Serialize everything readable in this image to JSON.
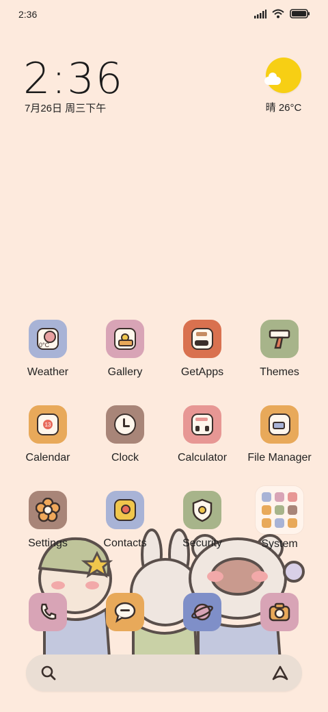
{
  "status_bar": {
    "time": "2:36"
  },
  "clock_widget": {
    "time": "2:36",
    "date": "7月26日 周三下午"
  },
  "weather_widget": {
    "text": "晴 26°C"
  },
  "apps": [
    {
      "id": "weather",
      "label": "Weather",
      "color": "#a8b3d6",
      "icon": "weather-icon"
    },
    {
      "id": "gallery",
      "label": "Gallery",
      "color": "#d8a4b6",
      "icon": "gallery-icon"
    },
    {
      "id": "getapps",
      "label": "GetApps",
      "color": "#d9714f",
      "icon": "getapps-icon"
    },
    {
      "id": "themes",
      "label": "Themes",
      "color": "#a7b48a",
      "icon": "themes-icon"
    },
    {
      "id": "calendar",
      "label": "Calendar",
      "color": "#e8a95a",
      "icon": "calendar-icon"
    },
    {
      "id": "clock",
      "label": "Clock",
      "color": "#a88578",
      "icon": "clock-icon"
    },
    {
      "id": "calculator",
      "label": "Calculator",
      "color": "#e79794",
      "icon": "calculator-icon"
    },
    {
      "id": "filemanager",
      "label": "File Manager",
      "color": "#e8a95a",
      "icon": "folder-icon"
    },
    {
      "id": "settings",
      "label": "Settings",
      "color": "#a88578",
      "icon": "flower-icon"
    },
    {
      "id": "contacts",
      "label": "Contacts",
      "color": "#a8b3d6",
      "icon": "contacts-icon"
    },
    {
      "id": "security",
      "label": "Security",
      "color": "#a7b48a",
      "icon": "shield-icon"
    },
    {
      "id": "system",
      "label": "System",
      "color": "#fff4ec",
      "icon": "folder-grid-icon"
    }
  ],
  "dock": [
    {
      "id": "phone",
      "color": "#d8a4b6",
      "icon": "phone-icon"
    },
    {
      "id": "messages",
      "color": "#e8a95a",
      "icon": "message-icon"
    },
    {
      "id": "browser",
      "color": "#7f8fc8",
      "icon": "planet-icon"
    },
    {
      "id": "camera",
      "color": "#d8a4b6",
      "icon": "camera-icon"
    }
  ],
  "weather_icon_text": "0°C",
  "calendar_icon_text": "13"
}
